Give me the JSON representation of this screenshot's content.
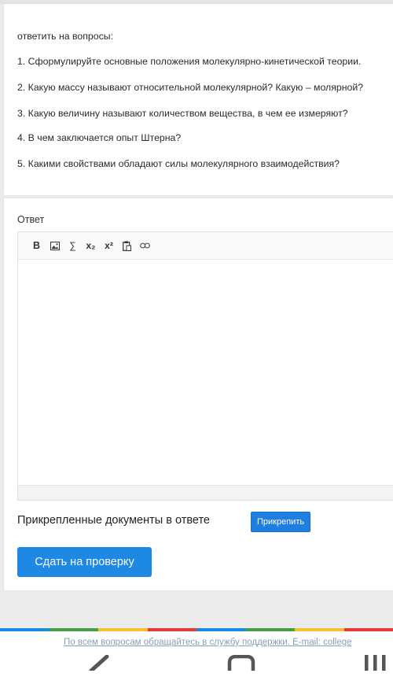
{
  "question": {
    "intro": "ответить на вопросы:",
    "items": [
      "1. Сформулируйте основные положения молекулярно-кинетической теории.",
      "2. Какую массу называют относительной молекулярной? Какую – молярной?",
      "3. Какую величину называют количеством вещества, в чем ее измеряют?",
      "4. В чем заключается опыт Штерна?",
      "5. Какими свойствами обладают силы молекулярного взаимодействия?"
    ]
  },
  "answer": {
    "label": "Ответ",
    "toolbar": [
      {
        "icon": "bold-icon",
        "glyph": "B"
      },
      {
        "icon": "image-icon",
        "glyph": ""
      },
      {
        "icon": "sigma-icon",
        "glyph": "∑"
      },
      {
        "icon": "subscript-icon",
        "glyph": "x₂"
      },
      {
        "icon": "superscript-icon",
        "glyph": "x²"
      },
      {
        "icon": "paste-icon",
        "glyph": ""
      },
      {
        "icon": "link-icon",
        "glyph": ""
      }
    ]
  },
  "attachments": {
    "title": "Прикрепленные документы в ответе",
    "attach_label": "Прикрепить"
  },
  "submit_label": "Сдать на проверку",
  "footer": {
    "text": "По всем вопросам обращайтесь в службу поддержки. E-mail: college"
  },
  "colors": {
    "primary": "#1e88e5",
    "rainbow": [
      "#1e88e5",
      "#43a047",
      "#fbc02d",
      "#e53935",
      "#1e88e5",
      "#43a047",
      "#fbc02d",
      "#e53935"
    ]
  }
}
